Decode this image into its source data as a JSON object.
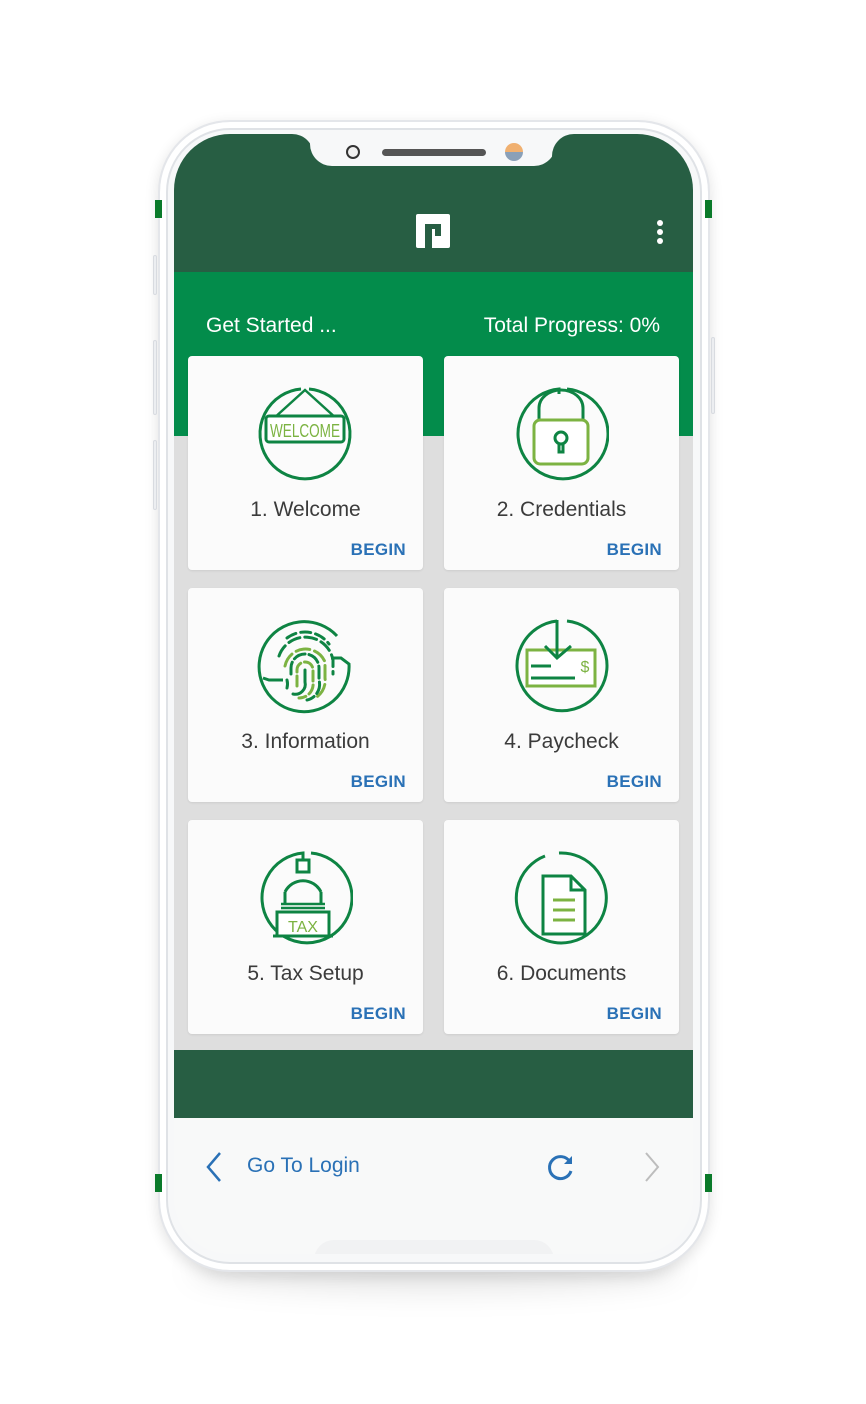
{
  "app": {
    "logo_icon": "paychex-logo-icon",
    "menu_icon": "more-vertical-icon"
  },
  "header": {
    "title": "Get Started ...",
    "progress_label": "Total Progress: 0%",
    "progress_percent": 0
  },
  "steps": [
    {
      "label": "1. Welcome",
      "action": "BEGIN",
      "icon": "welcome-sign-icon",
      "icon_text": "WELCOME"
    },
    {
      "label": "2. Credentials",
      "action": "BEGIN",
      "icon": "padlock-icon"
    },
    {
      "label": "3. Information",
      "action": "BEGIN",
      "icon": "fingerprint-icon"
    },
    {
      "label": "4. Paycheck",
      "action": "BEGIN",
      "icon": "paycheck-download-icon",
      "icon_text": "$"
    },
    {
      "label": "5. Tax Setup",
      "action": "BEGIN",
      "icon": "capitol-tax-icon",
      "icon_text": "TAX"
    },
    {
      "label": "6. Documents",
      "action": "BEGIN",
      "icon": "document-icon"
    }
  ],
  "footer": {
    "back_label": "Go To Login",
    "back_icon": "chevron-left-icon",
    "refresh_icon": "refresh-icon",
    "forward_icon": "chevron-right-icon"
  },
  "colors": {
    "dark_green": "#275e43",
    "brand_green": "#038c4b",
    "icon_dark_green": "#0e8443",
    "icon_light_green": "#7cb342",
    "link_blue": "#2a71b6",
    "card_bg": "#fbfbfb",
    "content_bg": "#dedede"
  }
}
